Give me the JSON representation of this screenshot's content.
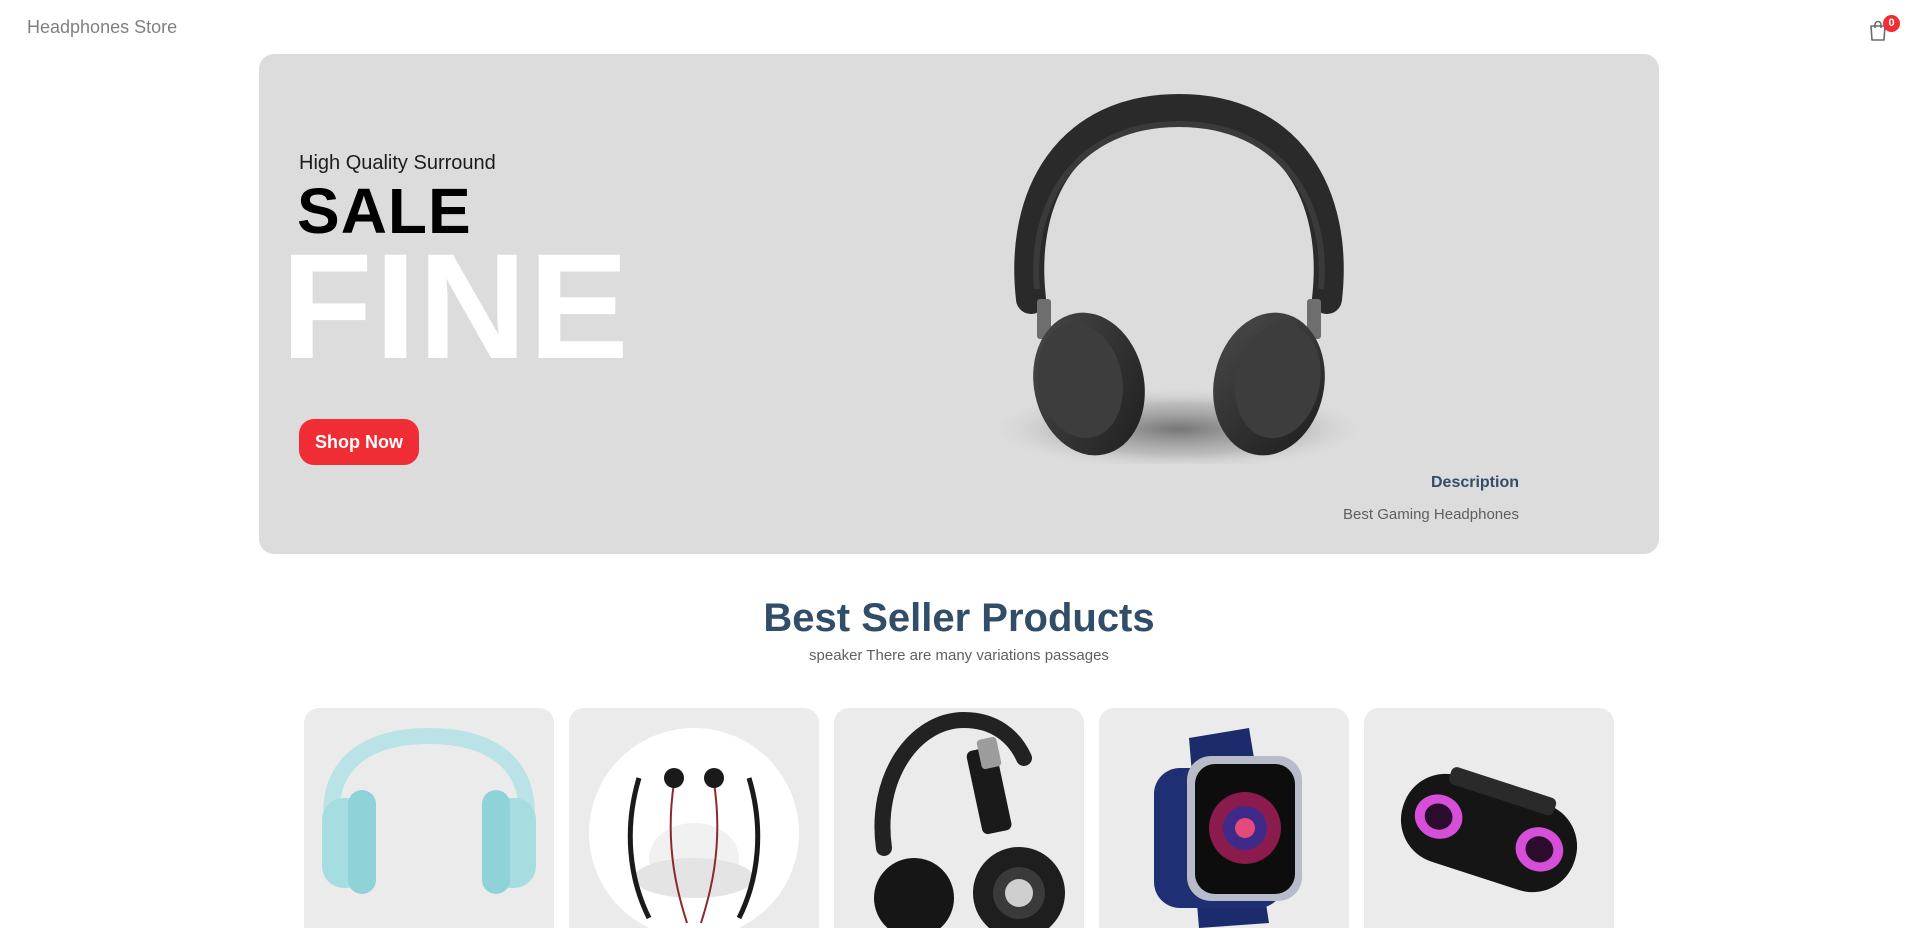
{
  "navbar": {
    "logo": "Headphones Store",
    "cart_icon": "shopping-bag-icon",
    "cart_count": "0"
  },
  "hero": {
    "small_text": "High Quality Surround",
    "mid_text": "SALE",
    "large_text": "FINE",
    "button_label": "Shop Now",
    "image_icon": "headphones-black-image",
    "description_title": "Description",
    "description_text": "Best Gaming Headphones"
  },
  "products": {
    "title": "Best Seller Products",
    "subtitle": "speaker There are many variations passages",
    "items": [
      {
        "image": "teal-headphones-image"
      },
      {
        "image": "neckband-earphones-image"
      },
      {
        "image": "boat-headphones-image"
      },
      {
        "image": "smartwatch-image"
      },
      {
        "image": "bluetooth-speaker-image"
      }
    ]
  },
  "colors": {
    "accent": "#f02d34",
    "heading": "#324d67",
    "banner_bg": "#dcdcdc",
    "card_bg": "#ebebeb"
  }
}
